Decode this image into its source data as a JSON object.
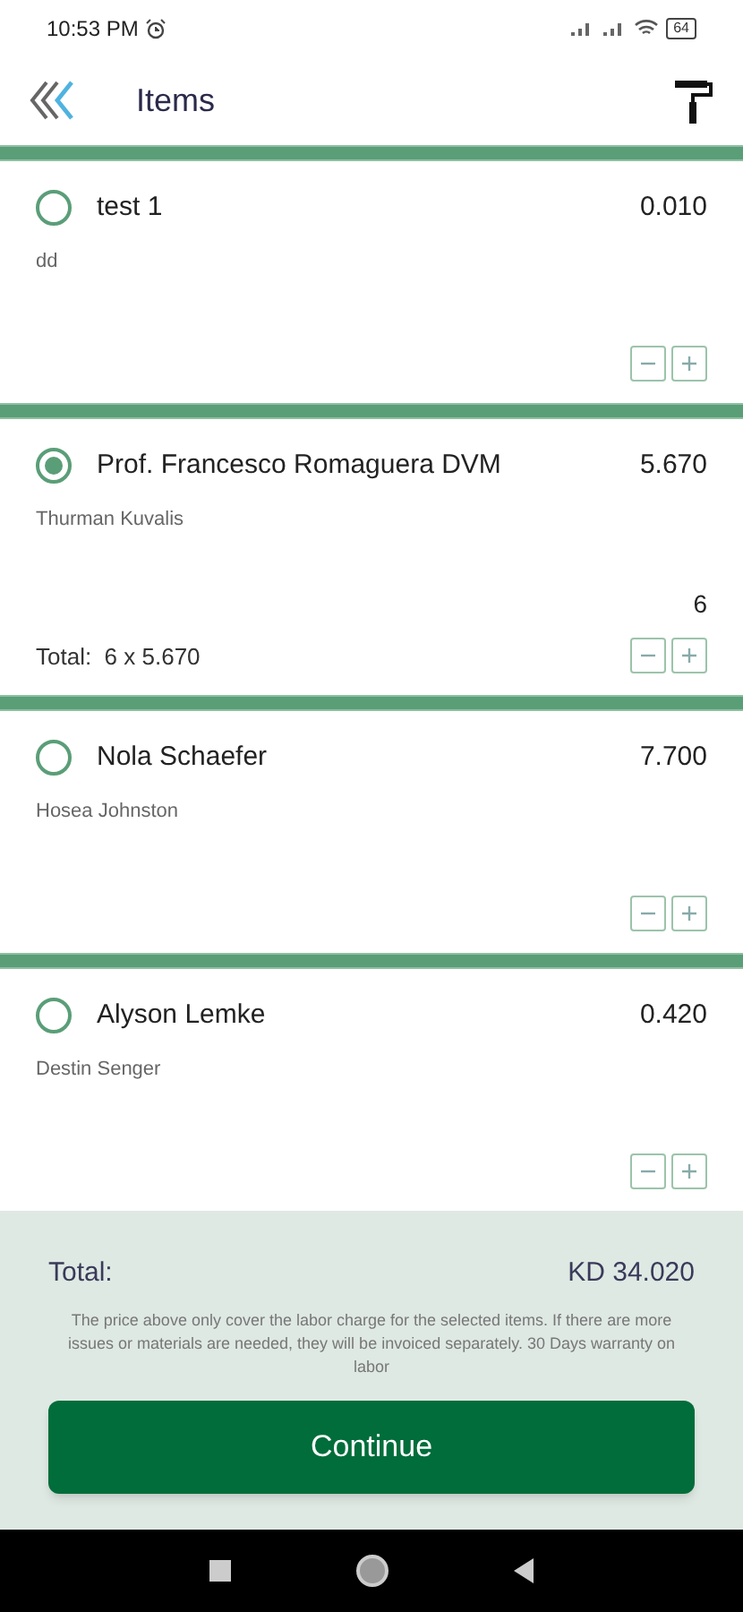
{
  "status_bar": {
    "time": "10:53 PM",
    "battery": "64"
  },
  "header": {
    "title": "Items"
  },
  "items": [
    {
      "name": "test 1",
      "price": "0.010",
      "subtitle": "dd",
      "selected": false
    },
    {
      "name": "Prof. Francesco Romaguera DVM",
      "price": "5.670",
      "subtitle": "Thurman Kuvalis",
      "selected": true,
      "quantity": "6",
      "total": "Total:  6 x 5.670"
    },
    {
      "name": "Nola Schaefer",
      "price": "7.700",
      "subtitle": "Hosea Johnston",
      "selected": false
    },
    {
      "name": "Alyson Lemke",
      "price": "0.420",
      "subtitle": "Destin Senger",
      "selected": false
    }
  ],
  "footer": {
    "total_label": "Total:",
    "total_value": "KD 34.020",
    "note": "The price above only cover the labor charge for the selected items. If there are more issues or materials are needed, they will be invoiced separately. 30 Days warranty on labor",
    "button": "Continue"
  }
}
